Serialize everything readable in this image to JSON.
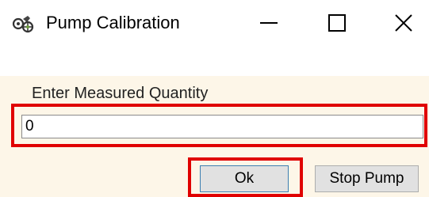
{
  "window": {
    "title": "Pump Calibration",
    "icon": "pump-icon",
    "controls": {
      "minimize_icon": "minimize-icon",
      "maximize_icon": "maximize-icon",
      "close_icon": "close-icon"
    }
  },
  "form": {
    "label": "Enter Measured Quantity",
    "quantity_value": "0"
  },
  "buttons": {
    "ok_label": "Ok",
    "stop_label": "Stop Pump"
  },
  "colors": {
    "content_background": "#fdf6e8",
    "highlight": "#e00000",
    "button_background": "#e1e1e1",
    "default_button_border": "#3c7fb1"
  }
}
